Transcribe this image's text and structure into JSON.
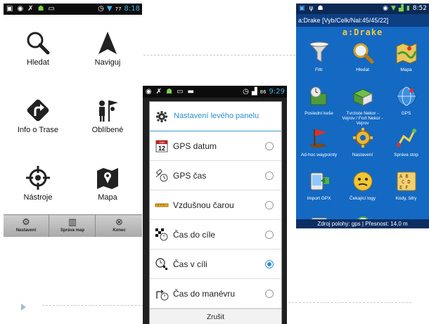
{
  "phone1": {
    "status_time": "8:18",
    "status_battery": "77",
    "items": [
      {
        "label": "Hledat",
        "icon": "search-icon"
      },
      {
        "label": "Naviguj",
        "icon": "navigate-icon"
      },
      {
        "label": "Info o Trase",
        "icon": "route-info-icon"
      },
      {
        "label": "Oblíbené",
        "icon": "favorites-icon"
      },
      {
        "label": "Nástroje",
        "icon": "tools-icon"
      },
      {
        "label": "Mapa",
        "icon": "map-icon"
      }
    ],
    "bottom_bar": [
      {
        "label": "Nastavení",
        "icon": "gear-icon"
      },
      {
        "label": "Správa map",
        "icon": "map-manage-icon"
      },
      {
        "label": "Konec",
        "icon": "exit-icon"
      }
    ]
  },
  "phone2": {
    "status_time": "9:29",
    "status_battery": "86",
    "dialog_title": "Nastavení levého panelu",
    "options": [
      {
        "label": "GPS datum",
        "icon": "calendar-icon",
        "icon_text_top": "JAN",
        "icon_text_bottom": "12",
        "selected": false
      },
      {
        "label": "GPS čas",
        "icon": "satellite-clock-icon",
        "selected": false
      },
      {
        "label": "Vzdušnou čarou",
        "icon": "ruler-icon",
        "selected": false
      },
      {
        "label": "Čas do cíle",
        "icon": "finish-flag-clock-icon",
        "selected": false
      },
      {
        "label": "Čas v cíli",
        "icon": "finish-clock-icon",
        "selected": true
      },
      {
        "label": "Čas do manévru",
        "icon": "turn-clock-icon",
        "selected": false
      }
    ],
    "cancel_label": "Zrušit"
  },
  "phone3": {
    "status_time": "8:52",
    "title": "a:Drake [Vyb/Celk/Nal:45/45/22]",
    "logo": "a:Drake",
    "items": [
      {
        "label": "Filtr",
        "icon": "funnel-icon"
      },
      {
        "label": "Hledat",
        "icon": "search-icon"
      },
      {
        "label": "Mapa",
        "icon": "map-icon"
      },
      {
        "label": "Poslední keše",
        "icon": "recent-caches-icon"
      },
      {
        "label": "Tvrziste Nekor - Vejrov / Fort Nekor - Vejrov",
        "icon": "cache-box-icon"
      },
      {
        "label": "GPS",
        "icon": "globe-icon"
      },
      {
        "label": "Ad-hoc waypointy",
        "icon": "flag-icon"
      },
      {
        "label": "Nastavení",
        "icon": "gear-icon"
      },
      {
        "label": "Správa stop",
        "icon": "track-icon"
      },
      {
        "label": "Import GPX",
        "icon": "import-icon"
      },
      {
        "label": "Čekající logy",
        "icon": "smiley-icon"
      },
      {
        "label": "Kódy, šifry",
        "icon": "cipher-icon"
      },
      {
        "label": "",
        "icon": "more-icon"
      },
      {
        "label": "",
        "icon": "more-icon"
      }
    ],
    "footer": "Zdroj polohy: gps | Přesnost: 14,0 m"
  },
  "colors": {
    "accent_blue": "#2c8fc8",
    "drake_bg": "#1469c2",
    "drake_logo": "#f3c644"
  }
}
